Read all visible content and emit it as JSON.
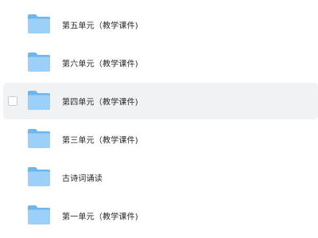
{
  "files": [
    {
      "name": "第五单元（教学课件)",
      "icon": "folder-icon",
      "selected": false
    },
    {
      "name": "第六单元（教学课件)",
      "icon": "folder-icon",
      "selected": false
    },
    {
      "name": "第四单元（教学课件)",
      "icon": "folder-icon",
      "selected": true
    },
    {
      "name": "第三单元（教学课件)",
      "icon": "folder-icon",
      "selected": false
    },
    {
      "name": "古诗词诵读",
      "icon": "folder-icon",
      "selected": false
    },
    {
      "name": "第一单元（教学课件)",
      "icon": "folder-icon",
      "selected": false
    }
  ],
  "colors": {
    "folder_back": "#6fb6ee",
    "folder_front": "#9dd0f8",
    "selected_row": "#f1f2f4"
  }
}
